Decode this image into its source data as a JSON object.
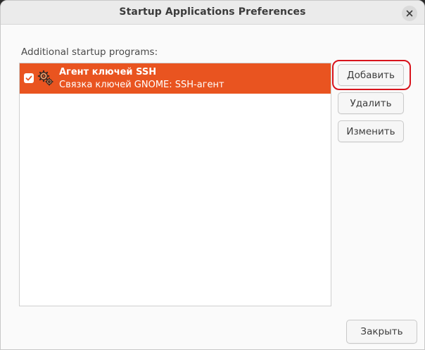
{
  "window": {
    "title": "Startup Applications Preferences"
  },
  "section_label": "Additional startup programs:",
  "programs": [
    {
      "name": "Агент ключей SSH",
      "description": "Связка ключей GNOME: SSH-агент",
      "enabled": true,
      "icon": "gears-icon"
    }
  ],
  "buttons": {
    "add": "Добавить",
    "remove": "Удалить",
    "edit": "Изменить",
    "close": "Закрыть"
  },
  "colors": {
    "selection": "#e95420",
    "highlight_ring": "#d8131c"
  }
}
